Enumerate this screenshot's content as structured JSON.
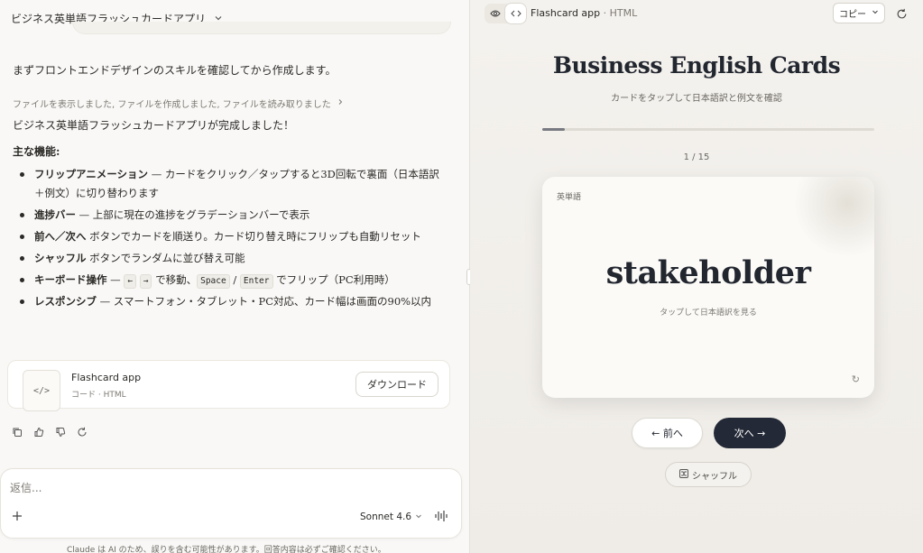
{
  "chat": {
    "title": "ビジネス英単語フラッシュカードアプリ",
    "intro": "まずフロントエンドデザインのスキルを確認してから作成します。",
    "tools_summary": "ファイルを表示しました, ファイルを作成しました, ファイルを読み取りました",
    "done": "ビジネス英単語フラッシュカードアプリが完成しました！",
    "features_heading": "主な機能:",
    "features": [
      {
        "bold": "フリップアニメーション",
        "text": " — カードをクリック／タップすると3D回転で裏面（日本語訳＋例文）に切り替わります"
      },
      {
        "bold": "進捗バー",
        "text": " — 上部に現在の進捗をグラデーションバーで表示"
      },
      {
        "bold": "前へ／次へ",
        "text": " ボタンでカードを順送り。カード切り替え時にフリップも自動リセット"
      },
      {
        "bold": "シャッフル",
        "text": " ボタンでランダムに並び替え可能"
      },
      {
        "bold": "レスポンシブ",
        "text": " — スマートフォン・タブレット・PC対応、カード幅は画面の90%以内"
      }
    ],
    "kb_feature": {
      "bold": "キーボード操作",
      "dash": " — ",
      "key_left": "←",
      "key_right": "→",
      "move": " で移動、",
      "key_space": "Space",
      "slash": " / ",
      "key_enter": "Enter",
      "flip": " でフリップ（PC利用時）"
    },
    "artifact": {
      "title": "Flashcard app",
      "subtitle": "コード · HTML",
      "thumb": "</>",
      "download": "ダウンロード"
    },
    "composer": {
      "placeholder": "返信...",
      "model": "Sonnet 4.6"
    },
    "disclaimer": "Claude は AI のため、誤りを含む可能性があります。回答内容は必ずご確認ください。"
  },
  "preview": {
    "title": "Flashcard app",
    "sep": " · ",
    "type": "HTML",
    "copy": "コピー",
    "app": {
      "title": "Business English Cards",
      "subtitle": "カードをタップして日本語訳と例文を確認",
      "progress": 0.067,
      "counter": "1 / 15",
      "card_tag": "英単語",
      "word": "stakeholder",
      "hint": "タップして日本語訳を見る",
      "flip_glyph": "↻",
      "prev": "← 前へ",
      "next": "次へ →",
      "shuffle": "シャッフル"
    }
  },
  "colors": {
    "accent": "#232936",
    "progress": "#777a80",
    "background": "#f4f2ee"
  },
  "icons": [
    "chevron-down-icon",
    "chevron-right-icon",
    "code-icon",
    "copy-icon",
    "thumbs-up-icon",
    "thumbs-down-icon",
    "retry-icon",
    "plus-icon",
    "voice-icon",
    "eye-icon",
    "refresh-icon",
    "shuffle-icon",
    "flip-icon"
  ]
}
